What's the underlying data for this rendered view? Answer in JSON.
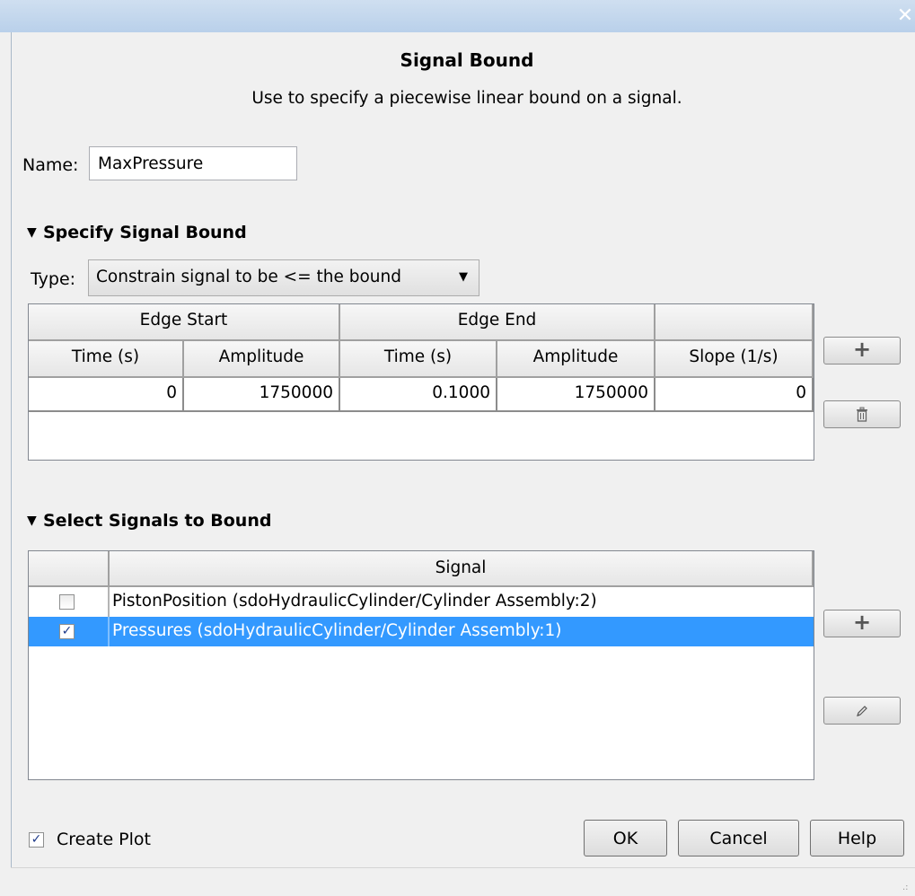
{
  "dialog": {
    "title": "Signal Bound",
    "subtitle": "Use to specify a piecewise linear bound on a signal."
  },
  "name": {
    "label": "Name:",
    "value": "MaxPressure"
  },
  "specify_section": {
    "title": "Specify Signal Bound",
    "type_label": "Type:",
    "type_value": "Constrain signal to be <= the bound"
  },
  "bound_table": {
    "group_headers": [
      "Edge Start",
      "Edge End",
      ""
    ],
    "columns": [
      "Time (s)",
      "Amplitude",
      "Time (s)",
      "Amplitude",
      "Slope (1/s)"
    ],
    "rows": [
      [
        "0",
        "1750000",
        "0.1000",
        "1750000",
        "0"
      ]
    ]
  },
  "select_section": {
    "title": "Select Signals to Bound",
    "column_header": "Signal",
    "signals": [
      {
        "name": "PistonPosition (sdoHydraulicCylinder/Cylinder Assembly:2)",
        "checked": false,
        "selected": false
      },
      {
        "name": "Pressures (sdoHydraulicCylinder/Cylinder Assembly:1)",
        "checked": true,
        "selected": true
      }
    ]
  },
  "create_plot": {
    "label": "Create Plot",
    "checked": true
  },
  "buttons": {
    "ok": "OK",
    "cancel": "Cancel",
    "help": "Help"
  },
  "icons": {
    "close": "close-icon",
    "add": "plus-icon",
    "delete": "trash-icon",
    "edit": "pencil-icon"
  },
  "colors": {
    "selection": "#3399ff",
    "titlebar": "#b9d0ea"
  }
}
